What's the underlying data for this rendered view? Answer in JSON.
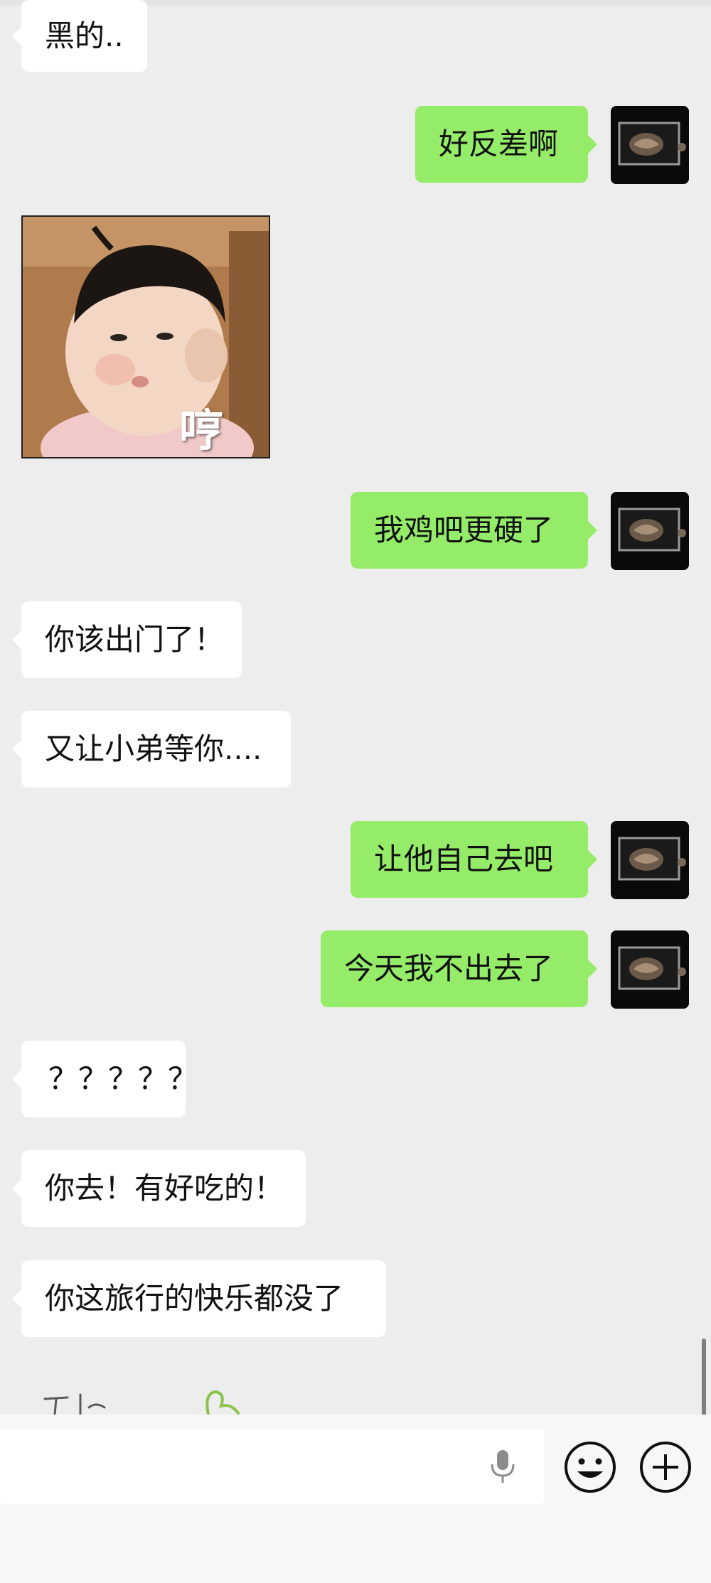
{
  "chat": {
    "messages": [
      {
        "sender": "contact",
        "text": "黑的.."
      },
      {
        "sender": "me",
        "text": "好反差啊"
      },
      {
        "sender": "contact",
        "sticker": "pouting-baby-sticker",
        "text": "哼"
      },
      {
        "sender": "me",
        "text": "我鸡吧更硬了"
      },
      {
        "sender": "contact",
        "text": "你该出门了！"
      },
      {
        "sender": "contact",
        "text": "又让小弟等你...."
      },
      {
        "sender": "me",
        "text": "让他自己去吧"
      },
      {
        "sender": "me",
        "text": "今天我不出去了"
      },
      {
        "sender": "contact",
        "text": "？？？？？"
      },
      {
        "sender": "contact",
        "text": "你去！有好吃的！"
      },
      {
        "sender": "contact",
        "text": "你这旅行的快乐都没了"
      }
    ]
  },
  "colors": {
    "background": "#ededed",
    "incoming_bubble": "#ffffff",
    "outgoing_bubble": "#95ec69",
    "input_bar": "#f7f7f7"
  },
  "input_bar": {
    "voice_icon": "microphone-icon",
    "emoji_icon": "smiley-icon",
    "add_icon": "plus-circle-icon"
  }
}
